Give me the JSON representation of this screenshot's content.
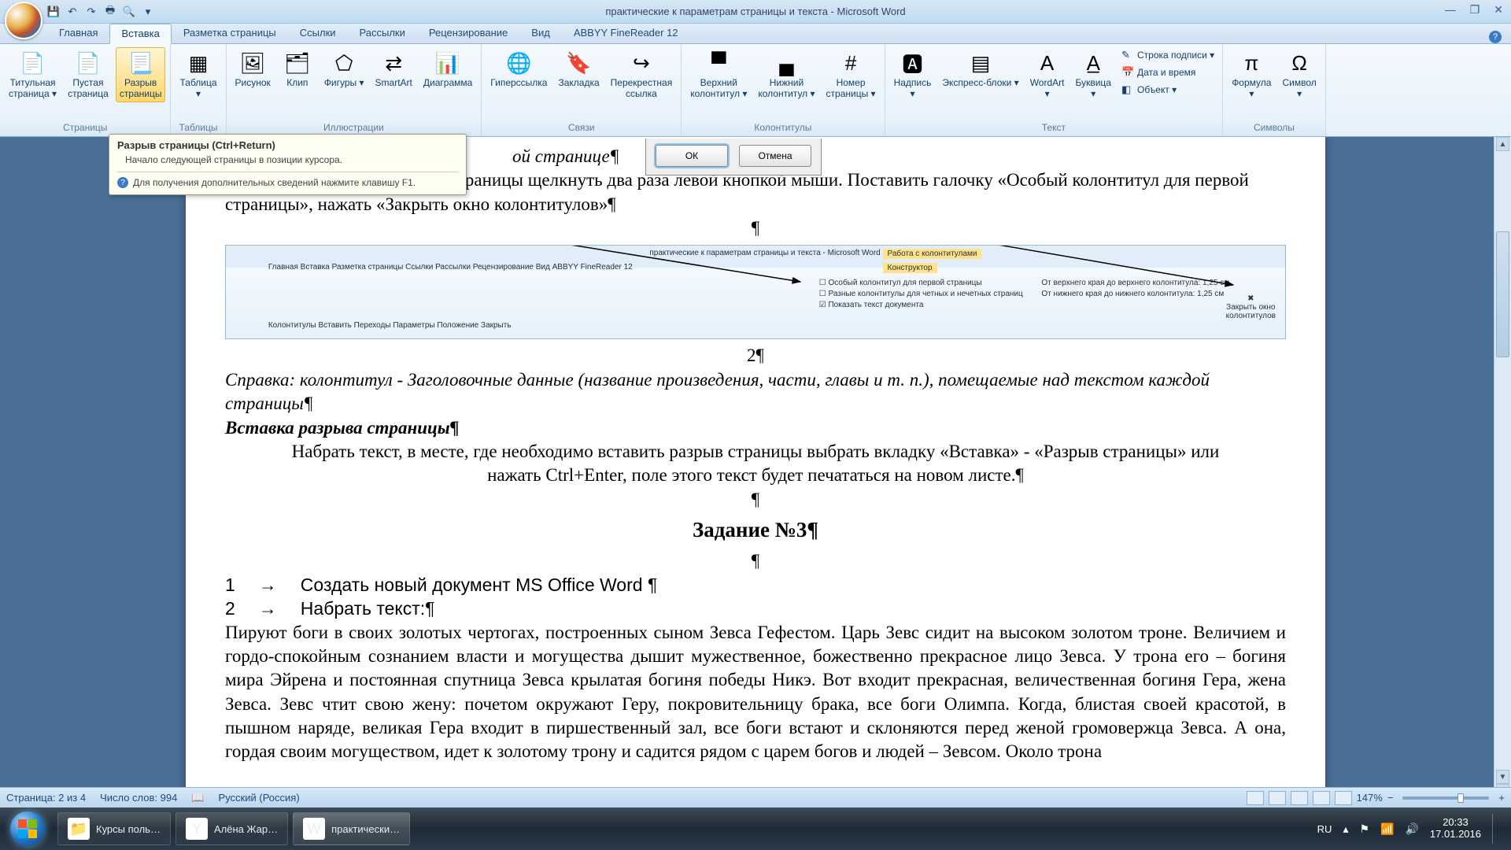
{
  "window": {
    "title": "практические к параметрам страницы и текста - Microsoft Word"
  },
  "qat": [
    "save-icon",
    "undo-icon",
    "redo-icon",
    "print-icon",
    "preview-icon"
  ],
  "tabs": {
    "items": [
      "Главная",
      "Вставка",
      "Разметка страницы",
      "Ссылки",
      "Рассылки",
      "Рецензирование",
      "Вид",
      "ABBYY FineReader 12"
    ],
    "active": 1
  },
  "ribbon": {
    "groups": [
      {
        "label": "Страницы",
        "buttons": [
          {
            "name": "title-page-button",
            "label": "Титульная\nстраница ▾",
            "icon": "📄"
          },
          {
            "name": "blank-page-button",
            "label": "Пустая\nстраница",
            "icon": "📄"
          },
          {
            "name": "page-break-button",
            "label": "Разрыв\nстраницы",
            "icon": "📃",
            "highlight": true
          }
        ]
      },
      {
        "label": "Таблицы",
        "buttons": [
          {
            "name": "table-button",
            "label": "Таблица\n▾",
            "icon": "▦"
          }
        ]
      },
      {
        "label": "Иллюстрации",
        "buttons": [
          {
            "name": "picture-button",
            "label": "Рисунок",
            "icon": "🖼"
          },
          {
            "name": "clip-button",
            "label": "Клип",
            "icon": "🗂"
          },
          {
            "name": "shapes-button",
            "label": "Фигуры ▾",
            "icon": "⬠"
          },
          {
            "name": "smartart-button",
            "label": "SmartArt",
            "icon": "⇄"
          },
          {
            "name": "chart-button",
            "label": "Диаграмма",
            "icon": "📊"
          }
        ]
      },
      {
        "label": "Связи",
        "buttons": [
          {
            "name": "hyperlink-button",
            "label": "Гиперссылка",
            "icon": "🌐"
          },
          {
            "name": "bookmark-button",
            "label": "Закладка",
            "icon": "🔖"
          },
          {
            "name": "crossref-button",
            "label": "Перекрестная\nссылка",
            "icon": "↪"
          }
        ]
      },
      {
        "label": "Колонтитулы",
        "buttons": [
          {
            "name": "header-button",
            "label": "Верхний\nколонтитул ▾",
            "icon": "▀"
          },
          {
            "name": "footer-button",
            "label": "Нижний\nколонтитул ▾",
            "icon": "▄"
          },
          {
            "name": "page-number-button",
            "label": "Номер\nстраницы ▾",
            "icon": "#"
          }
        ]
      },
      {
        "label": "Текст",
        "buttons": [
          {
            "name": "textbox-button",
            "label": "Надпись\n▾",
            "icon": "🅰"
          },
          {
            "name": "quickparts-button",
            "label": "Экспресс-блоки ▾",
            "icon": "▤"
          },
          {
            "name": "wordart-button",
            "label": "WordArt\n▾",
            "icon": "A"
          },
          {
            "name": "dropcap-button",
            "label": "Буквица\n▾",
            "icon": "A̲"
          }
        ],
        "small": [
          {
            "name": "signature-line-button",
            "label": "Строка подписи ▾",
            "icon": "✎"
          },
          {
            "name": "date-time-button",
            "label": "Дата и время",
            "icon": "📅"
          },
          {
            "name": "object-button",
            "label": "Объект ▾",
            "icon": "◧"
          }
        ]
      },
      {
        "label": "Символы",
        "buttons": [
          {
            "name": "equation-button",
            "label": "Формула\n▾",
            "icon": "π"
          },
          {
            "name": "symbol-button",
            "label": "Символ\n▾",
            "icon": "Ω"
          }
        ]
      }
    ]
  },
  "tooltip": {
    "title": "Разрыв страницы (Ctrl+Return)",
    "body": "Начало следующей страницы в позиции курсора.",
    "help": "Для получения дополнительных сведений нажмите клавишу F1."
  },
  "dialog": {
    "ok": "ОК",
    "cancel": "Отмена"
  },
  "document": {
    "line_frag": "ой странице¶",
    "para1": "Вставить номер – по номеру страницы щелкнуть два раза левой кнопкой мыши. Поставить галочку «Особый колонтитул для первой страницы», нажать «Закрыть окно колонтитулов»¶",
    "caption": "Справка: колонтитул - Заголовочные данные (название произведения, части, главы и т. п.), помещаемые над текстом каждой страницы¶",
    "heading_insert": "Вставка разрыва страницы¶",
    "para2": "Набрать текст, в месте, где необходимо вставить разрыв страницы выбрать вкладку «Вставка» - «Разрыв страницы» или нажать Ctrl+Enter, поле этого текст будет печататься на новом листе.¶",
    "heading_task": "Задание №3¶",
    "list1_num": "1",
    "list1_arrow": "→",
    "list1_text": "Создать новый документ MS Office Word ¶",
    "list2_num": "2",
    "list2_arrow": "→",
    "list2_text": "Набрать текст:¶",
    "body": "Пируют боги в своих золотых чертогах, построенных сыном Зевса Гефестом. Царь Зевс сидит на высоком золотом троне. Величием и гордо-спокойным сознанием власти и могущества дышит мужественное, божественно прекрасное лицо Зевса. У трона его – богиня мира Эйрена и постоянная спутница Зевса крылатая богиня победы Никэ. Вот входит прекрасная, величественная богиня Гера, жена Зевса. Зевс чтит свою жену: почетом окружают Геру, покровительницу брака, все боги Олимпа. Когда, блистая своей красотой, в пышном наряде, великая Гера входит в пиршественный зал, все боги встают и склоняются перед женой громовержца Зевса. А она, гордая своим могуществом, идет к золотому трону и садится рядом с царем богов и людей – Зевсом. Около трона"
  },
  "statusbar": {
    "page": "Страница: 2 из 4",
    "words": "Число слов: 994",
    "lang": "Русский (Россия)",
    "zoom": "147%"
  },
  "taskbar": {
    "items": [
      {
        "name": "explorer-task",
        "label": "Курсы поль…",
        "icon": "📁"
      },
      {
        "name": "browser-task",
        "label": "Алёна Жар…",
        "icon": "Y"
      },
      {
        "name": "word-task",
        "label": "практически…",
        "icon": "W",
        "active": true
      }
    ],
    "lang": "RU",
    "time": "20:33",
    "date": "17.01.2016"
  }
}
